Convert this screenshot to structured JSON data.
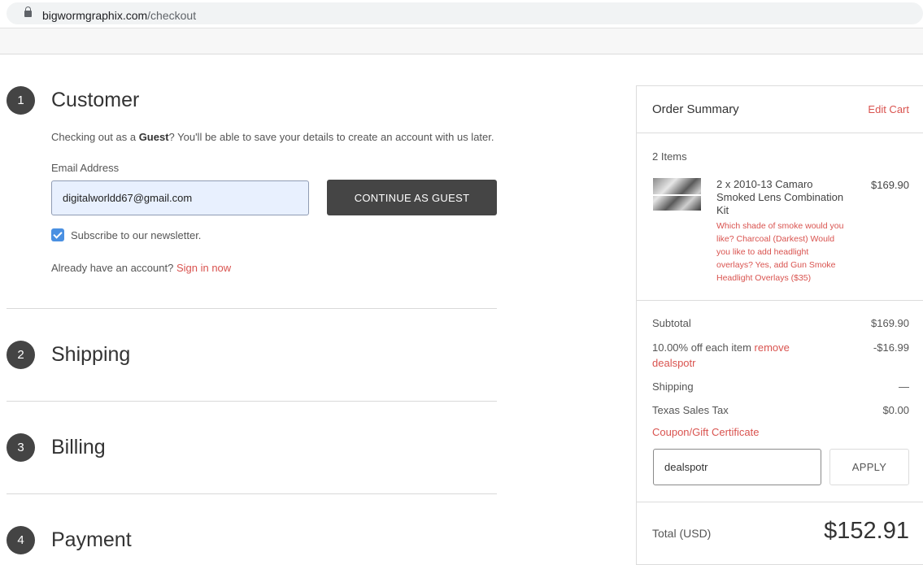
{
  "browser": {
    "url_host": "bigwormgraphix.com",
    "url_path": "/checkout"
  },
  "steps": [
    {
      "number": "1",
      "title": "Customer"
    },
    {
      "number": "2",
      "title": "Shipping"
    },
    {
      "number": "3",
      "title": "Billing"
    },
    {
      "number": "4",
      "title": "Payment"
    }
  ],
  "customer": {
    "intro_prefix": "Checking out as a ",
    "intro_bold": "Guest",
    "intro_suffix": "? You'll be able to save your details to create an account with us later.",
    "email_label": "Email Address",
    "email_value": "digitalworldd67@gmail.com",
    "continue_button": "CONTINUE AS GUEST",
    "newsletter_label": "Subscribe to our newsletter.",
    "newsletter_checked": true,
    "account_prompt": "Already have an account?",
    "sign_in_link": "Sign in now"
  },
  "summary": {
    "title": "Order Summary",
    "edit_cart": "Edit Cart",
    "items_count": "2 Items",
    "product": {
      "name": "2 x 2010-13 Camaro Smoked Lens Combination Kit",
      "price": "$169.90",
      "options": "Which shade of smoke would you like? Charcoal (Darkest) Would you like to add headlight overlays? Yes, add Gun Smoke Headlight Overlays ($35)"
    },
    "subtotal_label": "Subtotal",
    "subtotal_value": "$169.90",
    "discount_label": "10.00% off each item",
    "discount_remove": "remove",
    "discount_code": "dealspotr",
    "discount_value": "-$16.99",
    "shipping_label": "Shipping",
    "shipping_value": "—",
    "tax_label": "Texas Sales Tax",
    "tax_value": "$0.00",
    "coupon_link": "Coupon/Gift Certificate",
    "coupon_value": "dealspotr",
    "apply_button": "APPLY",
    "total_label": "Total (USD)",
    "total_value": "$152.91"
  },
  "colors": {
    "accent_link": "#d9534f",
    "step_circle": "#444444",
    "guest_button": "#454545",
    "checkbox": "#4a90e2"
  }
}
